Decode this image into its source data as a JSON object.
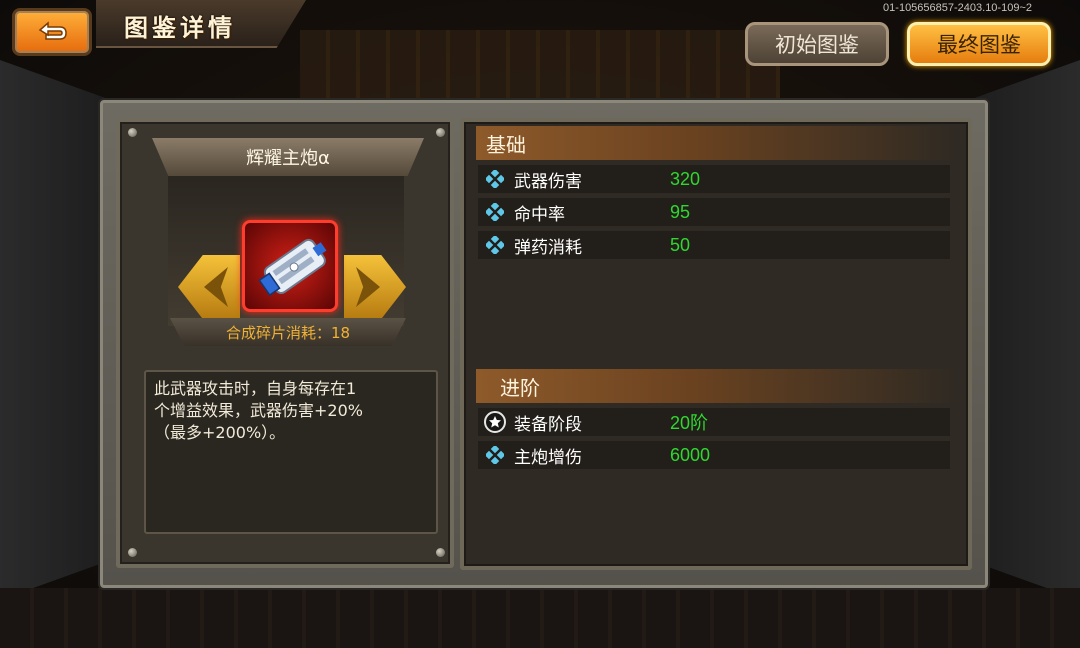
{
  "header": {
    "title": "图鉴详情",
    "version": "01-105656857-2403.10-109~2",
    "back_icon": "return-arrow-icon",
    "tab_initial": "初始图鉴",
    "tab_final": "最终图鉴"
  },
  "item": {
    "name": "辉耀主炮α",
    "icon": "main-cannon-icon",
    "fragment_cost": "合成碎片消耗：18",
    "description_lines": [
      "此武器攻击时，自身每存在1",
      "个增益效果，武器伤害+20%",
      "（最多+200%）。"
    ]
  },
  "sections": {
    "basic": {
      "title": "基础",
      "stats": [
        {
          "label": "武器伤害",
          "value": "320"
        },
        {
          "label": "命中率",
          "value": "95"
        },
        {
          "label": "弹药消耗",
          "value": "50"
        }
      ]
    },
    "advanced": {
      "title": "进阶",
      "stats": [
        {
          "label": "装备阶段",
          "value": "20阶",
          "icon": "star-icon"
        },
        {
          "label": "主炮增伤",
          "value": "6000",
          "icon": "diamond-icon"
        }
      ]
    }
  },
  "colors": {
    "stat_value": "#2fd82f",
    "fragment_text": "#f0b234",
    "accent_orange": "#e57d0f"
  }
}
